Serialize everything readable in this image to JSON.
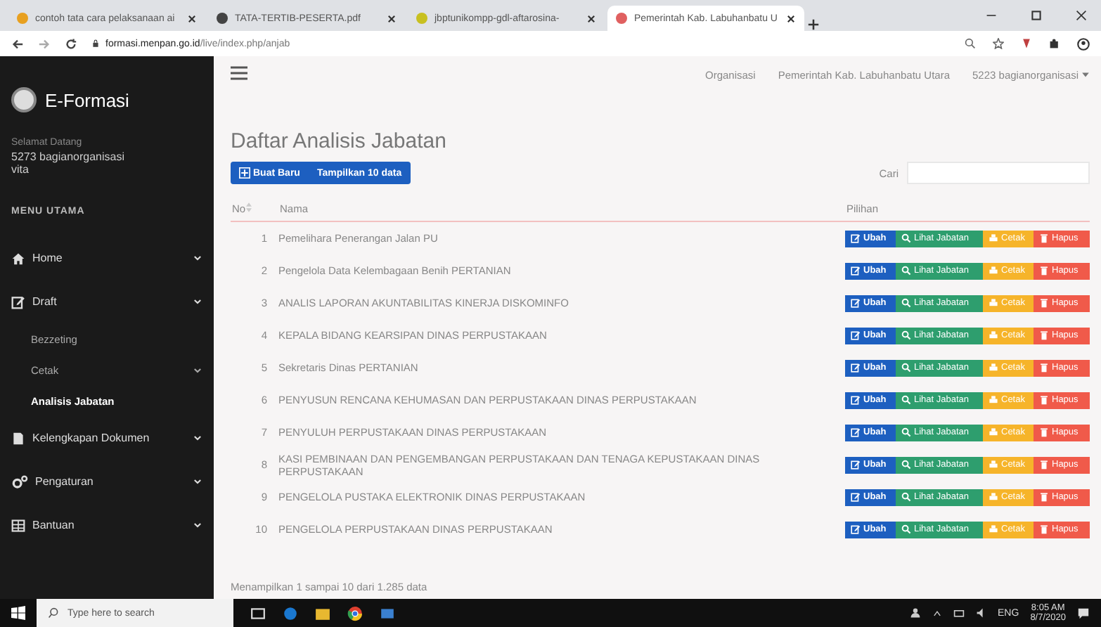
{
  "browser": {
    "tabs": [
      {
        "label": "contoh tata cara pelaksanaan ai",
        "selected": false
      },
      {
        "label": "TATA-TERTIB-PESERTA.pdf",
        "selected": false
      },
      {
        "label": "jbptunikompp-gdl-aftarosina-",
        "selected": false
      },
      {
        "label": "Pemerintah Kab. Labuhanbatu U",
        "selected": true
      }
    ],
    "url_host": "formasi.menpan.go.id",
    "url_path": "/live/index.php/anjab"
  },
  "sidebar": {
    "brand": "E-Formasi",
    "greeting": "Selamat Datang",
    "user": "5273 bagianorganisasi",
    "user_sub": "vita",
    "menu_heading": "MENU UTAMA",
    "items": [
      {
        "label": "Home"
      },
      {
        "label": "Draft",
        "children": [
          {
            "label": "Bezzeting",
            "selected": false,
            "kind": "link"
          },
          {
            "label": "Cetak",
            "selected": false,
            "kind": "group"
          },
          {
            "label": "Analisis Jabatan",
            "selected": true,
            "kind": "link"
          }
        ]
      },
      {
        "label": "Kelengkapan Dokumen"
      },
      {
        "label": "Pengaturan"
      },
      {
        "label": "Bantuan"
      }
    ]
  },
  "header": {
    "links": [
      "Organisasi",
      "Pemerintah Kab. Labuhanbatu Utara"
    ],
    "account": "5223 bagianorganisasi"
  },
  "page": {
    "title": "Daftar Analisis Jabatan",
    "new_button": "Buat Baru",
    "show_button": "Tampilkan 10 data",
    "search_label": "Cari",
    "columns": [
      "No",
      "Nama",
      "Pilihan"
    ],
    "rows": [
      {
        "no": "1",
        "name": "Pemelihara Penerangan Jalan PU",
        "actions": [
          {
            "label": "Ubah",
            "kind": "edit"
          },
          {
            "label": "Lihat Jabatan",
            "kind": "view"
          },
          {
            "label": "Cetak",
            "kind": "print"
          },
          {
            "label": "Hapus",
            "kind": "delete"
          }
        ]
      },
      {
        "no": "2",
        "name": "Pengelola Data Kelembagaan Benih PERTANIAN",
        "actions": [
          {
            "label": "Ubah",
            "kind": "edit"
          },
          {
            "label": "Lihat Jabatan",
            "kind": "view"
          },
          {
            "label": "Cetak",
            "kind": "print"
          },
          {
            "label": "Hapus",
            "kind": "delete"
          }
        ]
      },
      {
        "no": "3",
        "name": "ANALIS LAPORAN AKUNTABILITAS KINERJA DISKOMINFO",
        "actions": [
          {
            "label": "Ubah",
            "kind": "edit"
          },
          {
            "label": "Lihat Jabatan",
            "kind": "view"
          },
          {
            "label": "Cetak",
            "kind": "print"
          },
          {
            "label": "Hapus",
            "kind": "delete"
          }
        ]
      },
      {
        "no": "4",
        "name": "KEPALA BIDANG KEARSIPAN DINAS PERPUSTAKAAN",
        "actions": [
          {
            "label": "Ubah",
            "kind": "edit"
          },
          {
            "label": "Lihat Jabatan",
            "kind": "view"
          },
          {
            "label": "Cetak",
            "kind": "print"
          },
          {
            "label": "Hapus",
            "kind": "delete"
          }
        ]
      },
      {
        "no": "5",
        "name": "Sekretaris Dinas PERTANIAN",
        "actions": [
          {
            "label": "Ubah",
            "kind": "edit"
          },
          {
            "label": "Lihat Jabatan",
            "kind": "view"
          },
          {
            "label": "Cetak",
            "kind": "print"
          },
          {
            "label": "Hapus",
            "kind": "delete"
          }
        ]
      },
      {
        "no": "6",
        "name": "PENYUSUN RENCANA KEHUMASAN DAN PERPUSTAKAAN DINAS PERPUSTAKAAN",
        "actions": [
          {
            "label": "Ubah",
            "kind": "edit"
          },
          {
            "label": "Lihat Jabatan",
            "kind": "view"
          },
          {
            "label": "Cetak",
            "kind": "print"
          },
          {
            "label": "Hapus",
            "kind": "delete"
          }
        ]
      },
      {
        "no": "7",
        "name": "PENYULUH PERPUSTAKAAN DINAS PERPUSTAKAAN",
        "actions": [
          {
            "label": "Ubah",
            "kind": "edit"
          },
          {
            "label": "Lihat Jabatan",
            "kind": "view"
          },
          {
            "label": "Cetak",
            "kind": "print"
          },
          {
            "label": "Hapus",
            "kind": "delete"
          }
        ]
      },
      {
        "no": "8",
        "name": "KASI PEMBINAAN DAN PENGEMBANGAN PERPUSTAKAAN DAN TENAGA KEPUSTAKAAN DINAS PERPUSTAKAAN",
        "actions": [
          {
            "label": "Ubah",
            "kind": "edit"
          },
          {
            "label": "Lihat Jabatan",
            "kind": "view"
          },
          {
            "label": "Cetak",
            "kind": "print"
          },
          {
            "label": "Hapus",
            "kind": "delete"
          }
        ]
      },
      {
        "no": "9",
        "name": "PENGELOLA PUSTAKA ELEKTRONIK DINAS PERPUSTAKAAN",
        "actions": [
          {
            "label": "Ubah",
            "kind": "edit"
          },
          {
            "label": "Lihat Jabatan",
            "kind": "view"
          },
          {
            "label": "Cetak",
            "kind": "print"
          },
          {
            "label": "Hapus",
            "kind": "delete"
          }
        ]
      },
      {
        "no": "10",
        "name": "PENGELOLA PERPUSTAKAAN DINAS PERPUSTAKAAN",
        "actions": [
          {
            "label": "Ubah",
            "kind": "edit"
          },
          {
            "label": "Lihat Jabatan",
            "kind": "view"
          },
          {
            "label": "Cetak",
            "kind": "print"
          },
          {
            "label": "Hapus",
            "kind": "delete"
          }
        ]
      }
    ],
    "footer": "Menampilkan 1 sampai 10 dari 1.285 data"
  },
  "taskbar": {
    "search_placeholder": "Type here to search",
    "language": "ENG",
    "time": "8:05 AM",
    "date": "8/7/2020"
  }
}
